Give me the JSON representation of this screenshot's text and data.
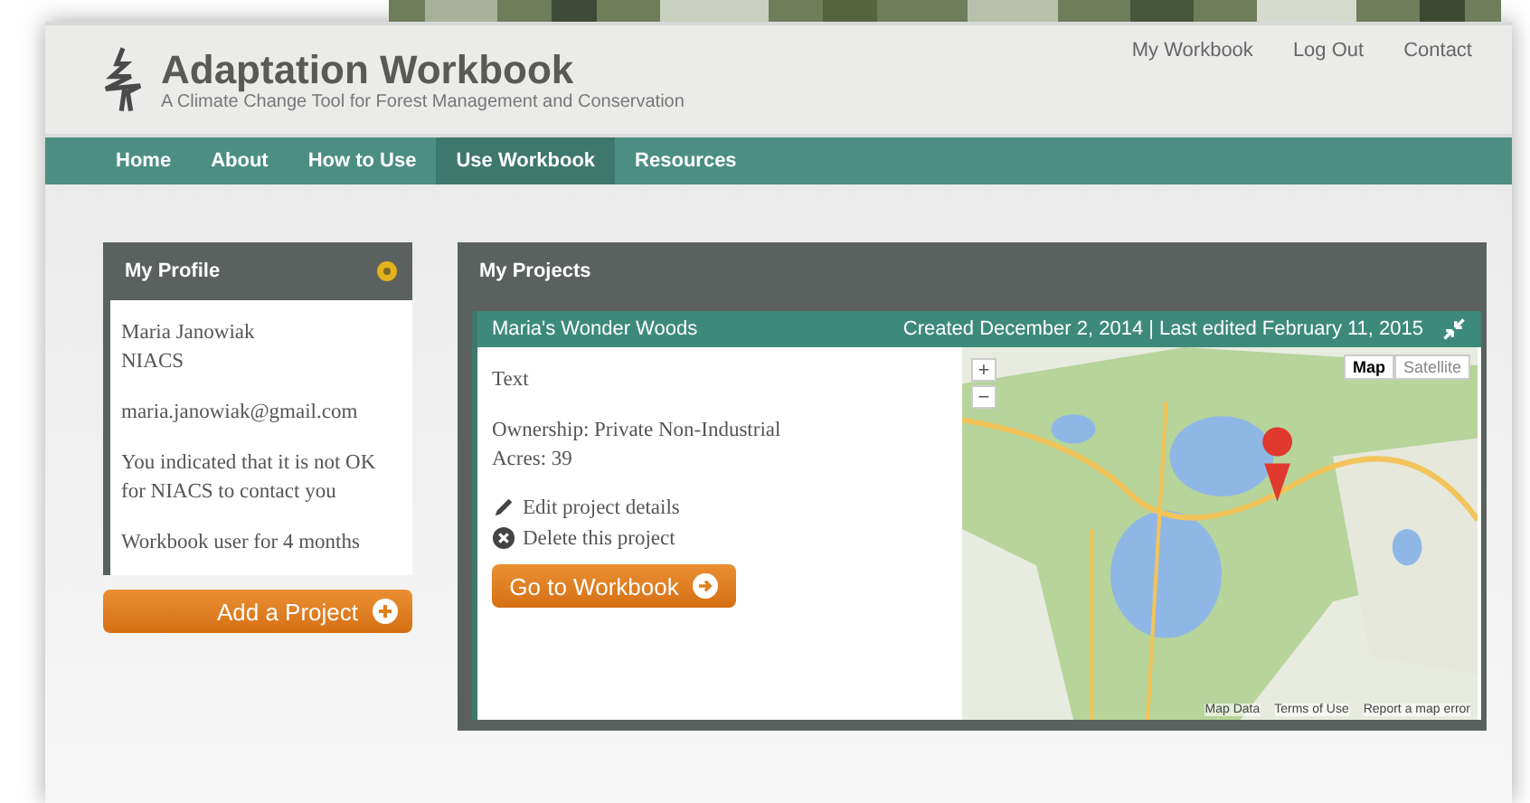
{
  "header": {
    "title": "Adaptation Workbook",
    "subtitle": "A Climate Change Tool for Forest Management and Conservation",
    "links": [
      "My Workbook",
      "Log Out",
      "Contact"
    ]
  },
  "nav": [
    {
      "label": "Home",
      "selected": false
    },
    {
      "label": "About",
      "selected": false
    },
    {
      "label": "How to Use",
      "selected": false
    },
    {
      "label": "Use Workbook",
      "selected": true
    },
    {
      "label": "Resources",
      "selected": false
    }
  ],
  "profile": {
    "title": "My Profile",
    "name": "Maria Janowiak",
    "org": "NIACS",
    "email": "maria.janowiak@gmail.com",
    "contact_note": "You indicated that it is not OK for NIACS to contact you",
    "tenure": "Workbook user for 4 months",
    "add_button": "Add a Project"
  },
  "projects": {
    "title": "My Projects",
    "items": [
      {
        "name": "Maria's Wonder Woods",
        "dates": "Created December 2, 2014 | Last edited February 11, 2015",
        "description": "Text",
        "ownership": "Ownership: Private Non-Industrial",
        "acres": "Acres: 39",
        "edit": "Edit project details",
        "delete": "Delete this project",
        "go_button": "Go to Workbook",
        "map": {
          "kind": "picture",
          "zoom_in": "+",
          "zoom_out": "−",
          "types": [
            {
              "label": "Map",
              "selected": true
            },
            {
              "label": "Satellite",
              "selected": false
            }
          ],
          "attribution": [
            "Map Data",
            "Terms of Use",
            "Report a map error"
          ]
        }
      }
    ]
  }
}
